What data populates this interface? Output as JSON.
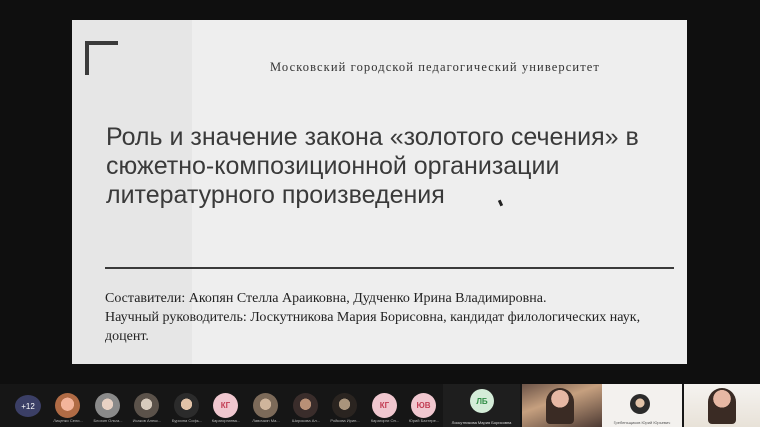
{
  "slide": {
    "university": "Московский городской педагогический университет",
    "title": "Роль и значение закона «золотого сечения» в сюжетно-композиционной организации литературного произведения",
    "authors": "Составители: Акопян Стелла Араиковна, Дудченко Ирина Владимировна.",
    "supervisor": "Научный руководитель: Лоскутникова Мария Борисовна, кандидат филологических наук, доцент."
  },
  "participants": {
    "more_count": "+12",
    "tiles": [
      {
        "name": "Лиценко Сели...",
        "icon": "photo-avatar"
      },
      {
        "name": "Блохин Ольга...",
        "icon": "photo-avatar"
      },
      {
        "name": "Исаков Алекс...",
        "icon": "photo-avatar"
      },
      {
        "name": "Бурсина Софь...",
        "icon": "photo-avatar"
      },
      {
        "name": "Карагоргиева...",
        "initials": "КГ"
      },
      {
        "name": "Лавочкин Ма...",
        "icon": "photo-avatar"
      },
      {
        "name": "Широкова Ал...",
        "icon": "photo-avatar"
      },
      {
        "name": "Ройкова Ирин...",
        "icon": "photo-avatar"
      },
      {
        "name": "Карагорги Ол...",
        "initials": "КГ"
      },
      {
        "name": "Юрий Бахтере...",
        "initials": "ЮВ"
      }
    ],
    "videos": [
      {
        "name": "Лоскутникова Мария Борисовна",
        "initials": "ЛБ"
      },
      {
        "name": ""
      },
      {
        "name": "Гребеньщиков Юрий Юрьевич"
      },
      {
        "name": ""
      }
    ]
  },
  "colors": {
    "slide_bg": "#eeeeee",
    "text_dark": "#3a3a3a",
    "badge_bg": "#3b3f66",
    "initials_pink": "#f0c7cf",
    "initials_green": "#d4ecd8"
  }
}
